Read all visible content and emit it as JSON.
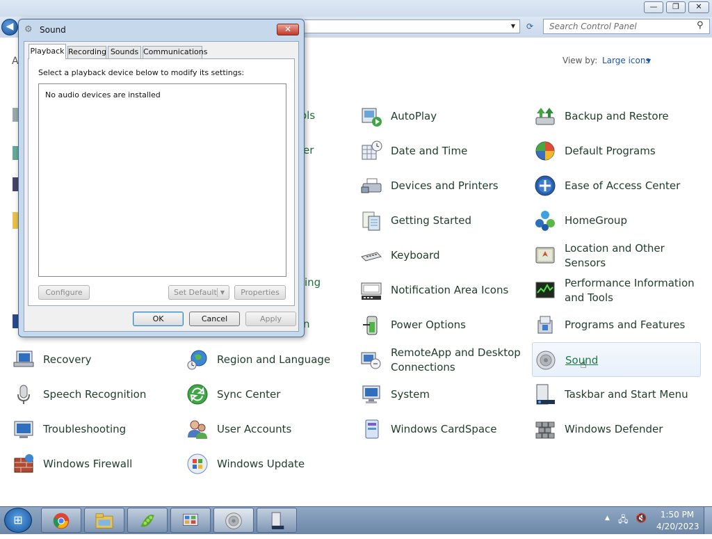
{
  "explorer": {
    "search_placeholder": "Search Control Panel",
    "partial_heading": "A",
    "view_by_label": "View by:",
    "view_by_value": "Large icons",
    "title_buttons": {
      "minimize": "—",
      "maximize": "❐",
      "close": "✕"
    }
  },
  "control_panel": {
    "partial_left": [
      "ols",
      "er",
      "ing",
      "n"
    ],
    "items": [
      {
        "label": "AutoPlay",
        "icon": "autoplay-icon"
      },
      {
        "label": "Backup and Restore",
        "icon": "backup-icon"
      },
      {
        "label": "Date and Time",
        "icon": "clock-icon"
      },
      {
        "label": "Default Programs",
        "icon": "default-programs-icon"
      },
      {
        "label": "Devices and Printers",
        "icon": "printer-icon"
      },
      {
        "label": "Ease of Access Center",
        "icon": "accessibility-icon"
      },
      {
        "label": "Getting Started",
        "icon": "getting-started-icon"
      },
      {
        "label": "HomeGroup",
        "icon": "homegroup-icon"
      },
      {
        "label": "Keyboard",
        "icon": "keyboard-icon"
      },
      {
        "label": "Location and Other Sensors",
        "icon": "location-icon"
      },
      {
        "label": "Notification Area Icons",
        "icon": "notification-icon"
      },
      {
        "label": "Performance Information and Tools",
        "icon": "performance-icon"
      },
      {
        "label": "Power Options",
        "icon": "battery-icon"
      },
      {
        "label": "Programs and Features",
        "icon": "programs-icon"
      },
      {
        "label": "Recovery",
        "icon": "recovery-icon"
      },
      {
        "label": "Region and Language",
        "icon": "globe-icon"
      },
      {
        "label": "RemoteApp and Desktop Connections",
        "icon": "remote-icon"
      },
      {
        "label": "Sound",
        "icon": "speaker-icon"
      },
      {
        "label": "Speech Recognition",
        "icon": "microphone-icon"
      },
      {
        "label": "Sync Center",
        "icon": "sync-icon"
      },
      {
        "label": "System",
        "icon": "system-icon"
      },
      {
        "label": "Taskbar and Start Menu",
        "icon": "taskbar-icon"
      },
      {
        "label": "Troubleshooting",
        "icon": "troubleshoot-icon"
      },
      {
        "label": "User Accounts",
        "icon": "users-icon"
      },
      {
        "label": "Windows CardSpace",
        "icon": "cardspace-icon"
      },
      {
        "label": "Windows Defender",
        "icon": "defender-icon"
      },
      {
        "label": "Windows Firewall",
        "icon": "firewall-icon"
      },
      {
        "label": "Windows Update",
        "icon": "update-icon"
      }
    ]
  },
  "dialog": {
    "title": "Sound",
    "close": "✕",
    "tabs": [
      "Playback",
      "Recording",
      "Sounds",
      "Communications"
    ],
    "instruction": "Select a playback device below to modify its settings:",
    "empty_message": "No audio devices are installed",
    "buttons": {
      "configure": "Configure",
      "set_default": "Set Default",
      "properties": "Properties",
      "ok": "OK",
      "cancel": "Cancel",
      "apply": "Apply"
    }
  },
  "taskbar": {
    "time": "1:50 PM",
    "date": "4/20/2023",
    "apps": [
      "chrome-icon",
      "explorer-icon",
      "peapod-icon",
      "control-panel-icon",
      "sound-icon",
      "server-icon"
    ]
  },
  "colors": {
    "link_green": "#1b6f3b",
    "accent_blue": "#1b56a8",
    "taskbar": "#6b86a8"
  }
}
